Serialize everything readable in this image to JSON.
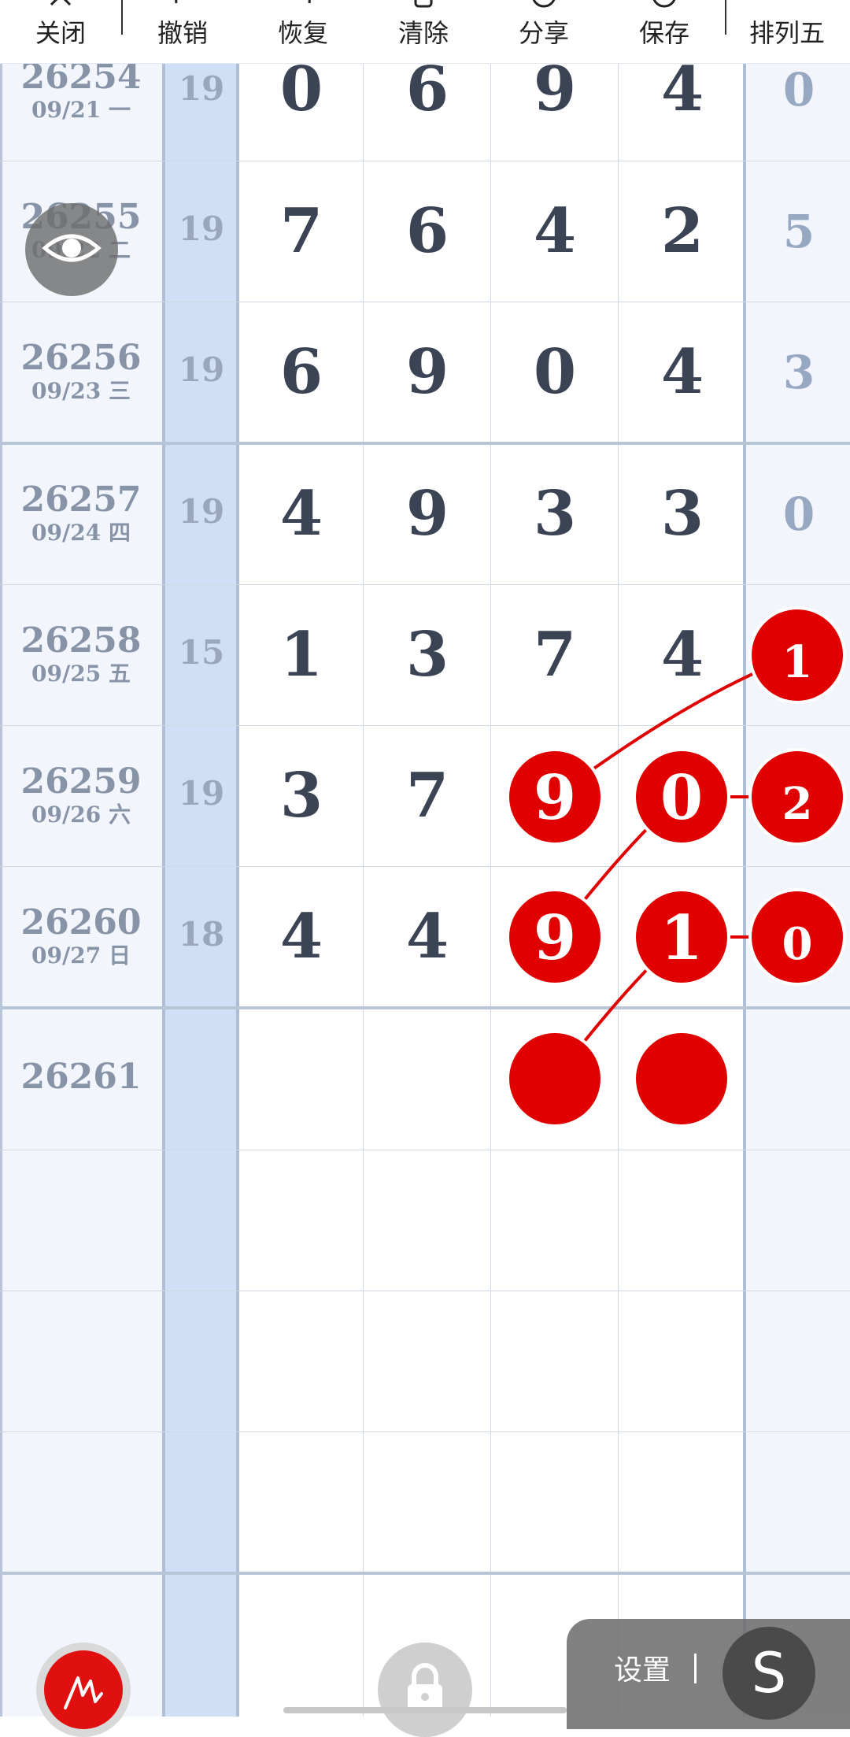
{
  "toolbar": {
    "buttons": [
      {
        "label": "关闭",
        "icon": "close-icon"
      },
      {
        "label": "撤销",
        "icon": "undo-icon"
      },
      {
        "label": "恢复",
        "icon": "redo-icon"
      },
      {
        "label": "清除",
        "icon": "clear-icon"
      },
      {
        "label": "分享",
        "icon": "share-icon"
      },
      {
        "label": "保存",
        "icon": "save-icon"
      },
      {
        "label": "排列五",
        "icon": ""
      }
    ]
  },
  "rows": [
    {
      "issue": "26254",
      "date": "09/21 一",
      "sum": "19",
      "digits": [
        "0",
        "6",
        "9",
        "4"
      ],
      "p5": "0"
    },
    {
      "issue": "26255",
      "date": "09/22 二",
      "sum": "19",
      "digits": [
        "7",
        "6",
        "4",
        "2"
      ],
      "p5": "5"
    },
    {
      "issue": "26256",
      "date": "09/23 三",
      "sum": "19",
      "digits": [
        "6",
        "9",
        "0",
        "4"
      ],
      "p5": "3"
    },
    {
      "issue": "26257",
      "date": "09/24 四",
      "sum": "19",
      "digits": [
        "4",
        "9",
        "3",
        "3"
      ],
      "p5": "0"
    },
    {
      "issue": "26258",
      "date": "09/25 五",
      "sum": "15",
      "digits": [
        "1",
        "3",
        "7",
        "4"
      ],
      "p5": "1"
    },
    {
      "issue": "26259",
      "date": "09/26 六",
      "sum": "19",
      "digits": [
        "3",
        "7",
        "9",
        "0"
      ],
      "p5": "2"
    },
    {
      "issue": "26260",
      "date": "09/27 日",
      "sum": "18",
      "digits": [
        "4",
        "4",
        "9",
        "1"
      ],
      "p5": "0"
    },
    {
      "issue": "26261",
      "date": "",
      "sum": "",
      "digits": [
        "",
        "",
        "",
        ""
      ],
      "p5": ""
    }
  ],
  "markers": [
    {
      "row": 4,
      "col": 4,
      "text": "1"
    },
    {
      "row": 5,
      "col": 2,
      "text": "9"
    },
    {
      "row": 5,
      "col": 3,
      "text": "0"
    },
    {
      "row": 5,
      "col": 4,
      "text": "2"
    },
    {
      "row": 6,
      "col": 2,
      "text": "9"
    },
    {
      "row": 6,
      "col": 3,
      "text": "1"
    },
    {
      "row": 6,
      "col": 4,
      "text": "0"
    },
    {
      "row": 7,
      "col": 2,
      "text": ""
    },
    {
      "row": 7,
      "col": 3,
      "text": ""
    }
  ],
  "lines": [
    {
      "from": [
        4,
        4
      ],
      "to": [
        5,
        2
      ]
    },
    {
      "from": [
        5,
        3
      ],
      "to": [
        5,
        4
      ]
    },
    {
      "from": [
        5,
        3
      ],
      "to": [
        6,
        2
      ]
    },
    {
      "from": [
        6,
        3
      ],
      "to": [
        6,
        4
      ]
    },
    {
      "from": [
        6,
        3
      ],
      "to": [
        7,
        2
      ]
    }
  ],
  "colors": {
    "marker": "#e00000",
    "sum_column": "#cfdff6",
    "issue_column": "#f2f6fc",
    "p5_column": "#f2f6fc"
  },
  "controls": {
    "eye_icon": "eye-icon",
    "pen_icon": "pen-icon",
    "lock_icon": "lock-icon",
    "settings_label": "设置",
    "s_label": "S"
  }
}
